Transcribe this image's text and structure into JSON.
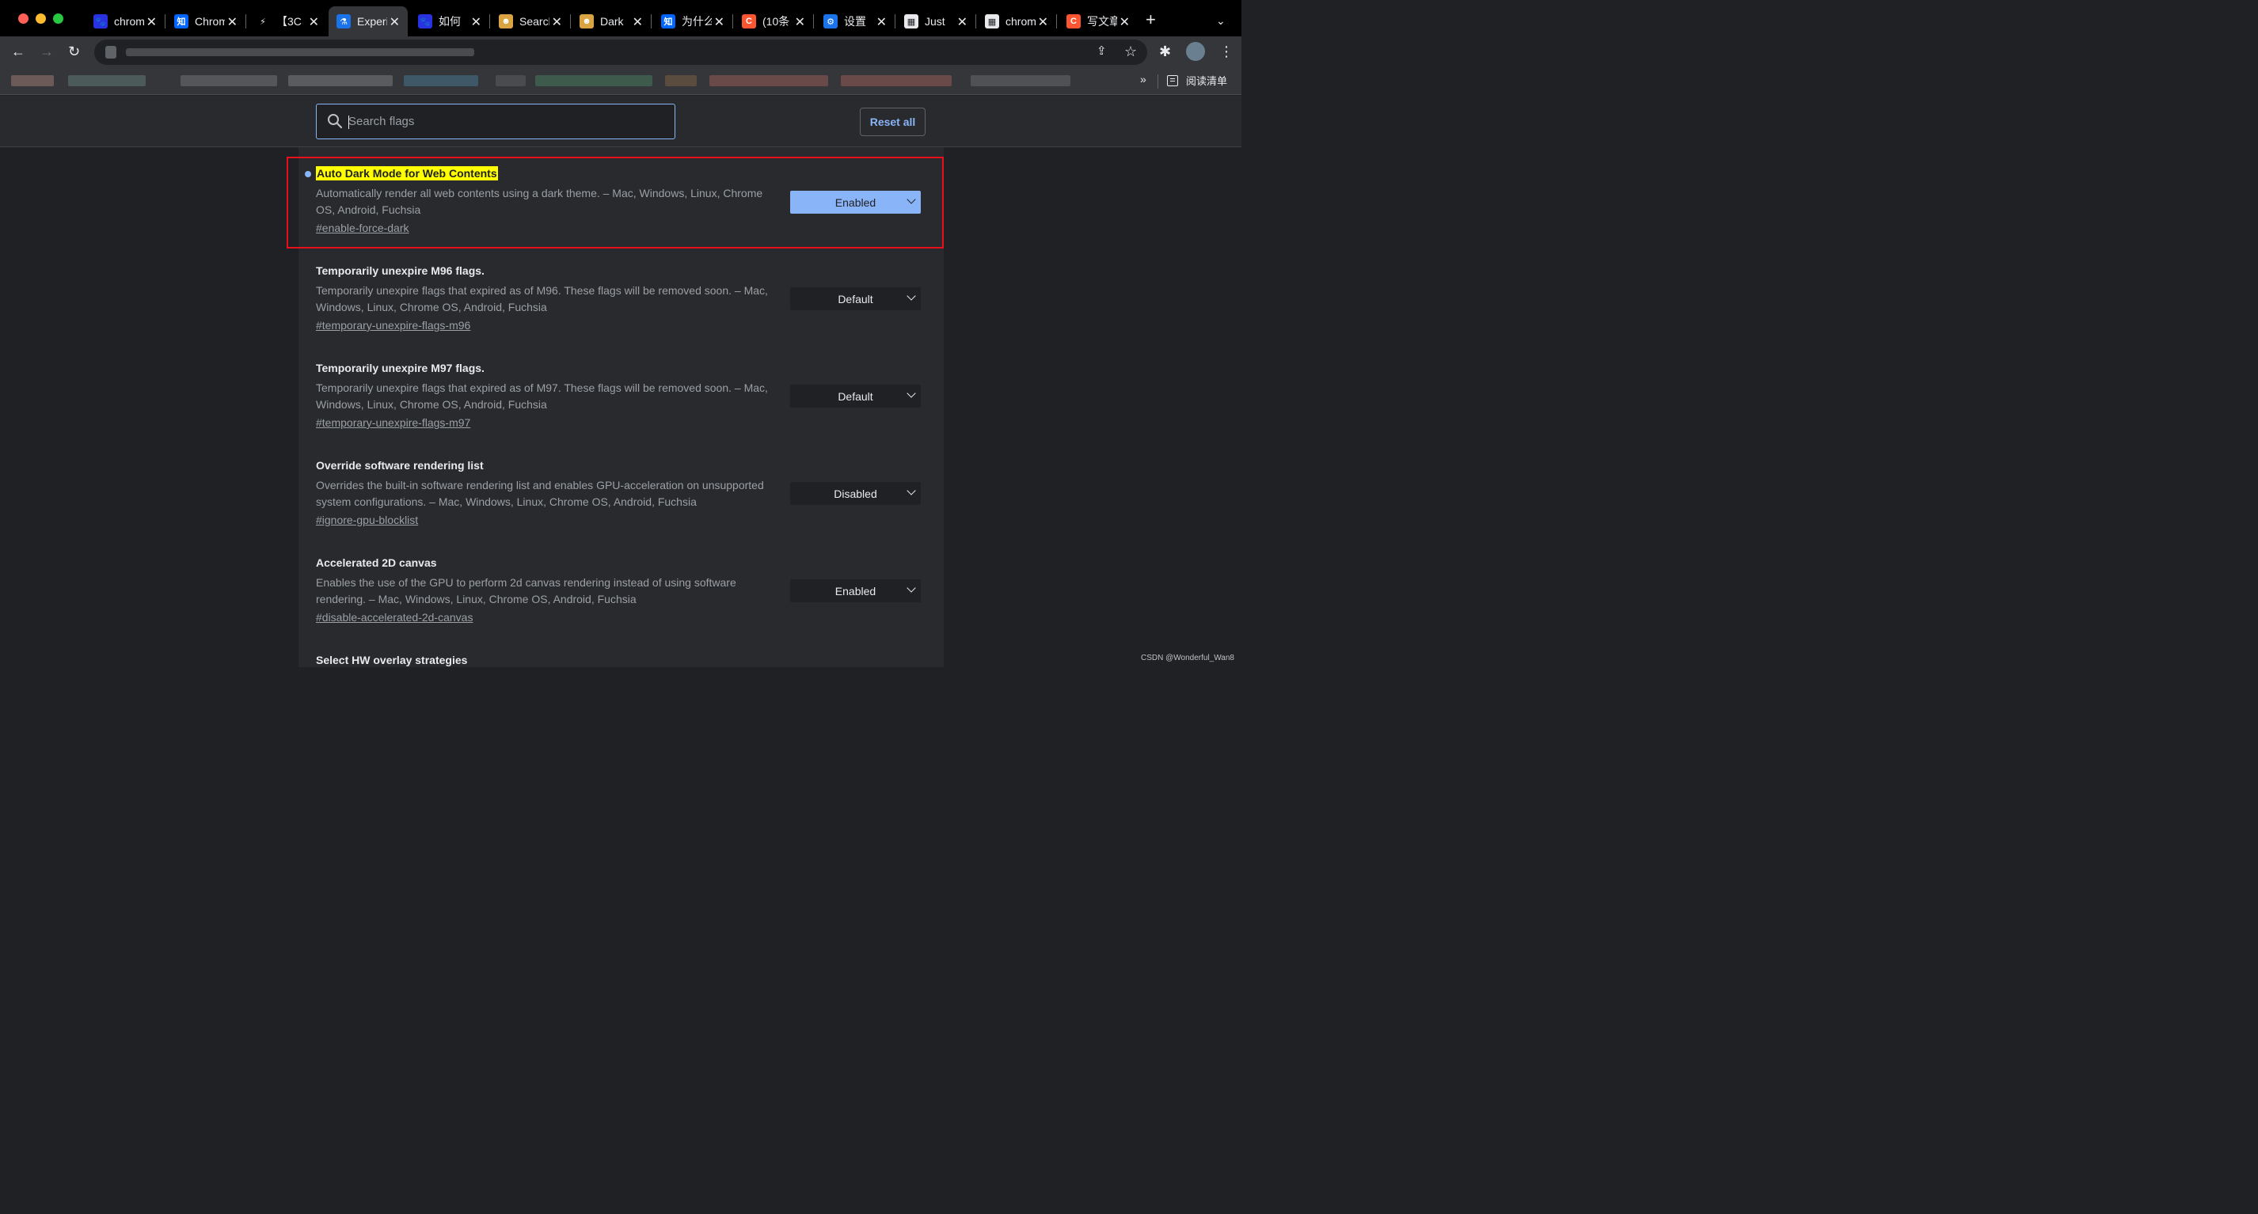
{
  "tabs": [
    {
      "title": "chrome",
      "favicon": "baidu-icon",
      "color": "#2932e1",
      "glyph": "🐾"
    },
    {
      "title": "Chrome",
      "favicon": "zhihu-icon",
      "color": "#0066ff",
      "glyph": "知"
    },
    {
      "title": "【3C",
      "favicon": "lightning-icon",
      "color": "#000000",
      "glyph": "⚡"
    },
    {
      "title": "Experiments",
      "favicon": "flask-icon",
      "color": "#1a73e8",
      "glyph": "⚗",
      "active": true
    },
    {
      "title": "如何",
      "favicon": "baidu-icon",
      "color": "#2932e1",
      "glyph": "🐾"
    },
    {
      "title": "Search",
      "favicon": "dark-reader-icon",
      "color": "#d9a441",
      "glyph": "☻"
    },
    {
      "title": "Dark",
      "favicon": "dark-reader-icon",
      "color": "#d9a441",
      "glyph": "☻"
    },
    {
      "title": "为什么",
      "favicon": "zhihu-icon",
      "color": "#0066ff",
      "glyph": "知"
    },
    {
      "title": "(10条",
      "favicon": "csdn-icon",
      "color": "#fc5531",
      "glyph": "C"
    },
    {
      "title": "设置",
      "favicon": "gear-icon",
      "color": "#1a73e8",
      "glyph": "⚙"
    },
    {
      "title": "Just",
      "favicon": "chrome-store-icon",
      "color": "#e8eaed",
      "glyph": "▦"
    },
    {
      "title": "chrome",
      "favicon": "chrome-store-icon",
      "color": "#e8eaed",
      "glyph": "▦"
    },
    {
      "title": "写文章",
      "favicon": "csdn-icon",
      "color": "#fc5531",
      "glyph": "C"
    }
  ],
  "bookmarks": {
    "more_label": "»",
    "reading_list_label": "阅读清单"
  },
  "search": {
    "placeholder": "Search flags"
  },
  "reset_label": "Reset all",
  "flags": [
    {
      "title": "Auto Dark Mode for Web Contents",
      "description": "Automatically render all web contents using a dark theme. – Mac, Windows, Linux, Chrome OS, Android, Fuchsia",
      "link": "#enable-force-dark",
      "value": "Enabled",
      "highlighted": true
    },
    {
      "title": "Temporarily unexpire M96 flags.",
      "description": "Temporarily unexpire flags that expired as of M96. These flags will be removed soon. – Mac, Windows, Linux, Chrome OS, Android, Fuchsia",
      "link": "#temporary-unexpire-flags-m96",
      "value": "Default"
    },
    {
      "title": "Temporarily unexpire M97 flags.",
      "description": "Temporarily unexpire flags that expired as of M97. These flags will be removed soon. – Mac, Windows, Linux, Chrome OS, Android, Fuchsia",
      "link": "#temporary-unexpire-flags-m97",
      "value": "Default"
    },
    {
      "title": "Override software rendering list",
      "description": "Overrides the built-in software rendering list and enables GPU-acceleration on unsupported system configurations. – Mac, Windows, Linux, Chrome OS, Android, Fuchsia",
      "link": "#ignore-gpu-blocklist",
      "value": "Disabled"
    },
    {
      "title": "Accelerated 2D canvas",
      "description": "Enables the use of the GPU to perform 2d canvas rendering instead of using software rendering. – Mac, Windows, Linux, Chrome OS, Android, Fuchsia",
      "link": "#disable-accelerated-2d-canvas",
      "value": "Enabled"
    },
    {
      "title": "Select HW overlay strategies"
    }
  ],
  "watermark": "CSDN @Wonderful_Wan8",
  "colors": {
    "accent": "#8ab4f8",
    "highlight": "#ffff00",
    "annotation_box": "#e8101b"
  }
}
